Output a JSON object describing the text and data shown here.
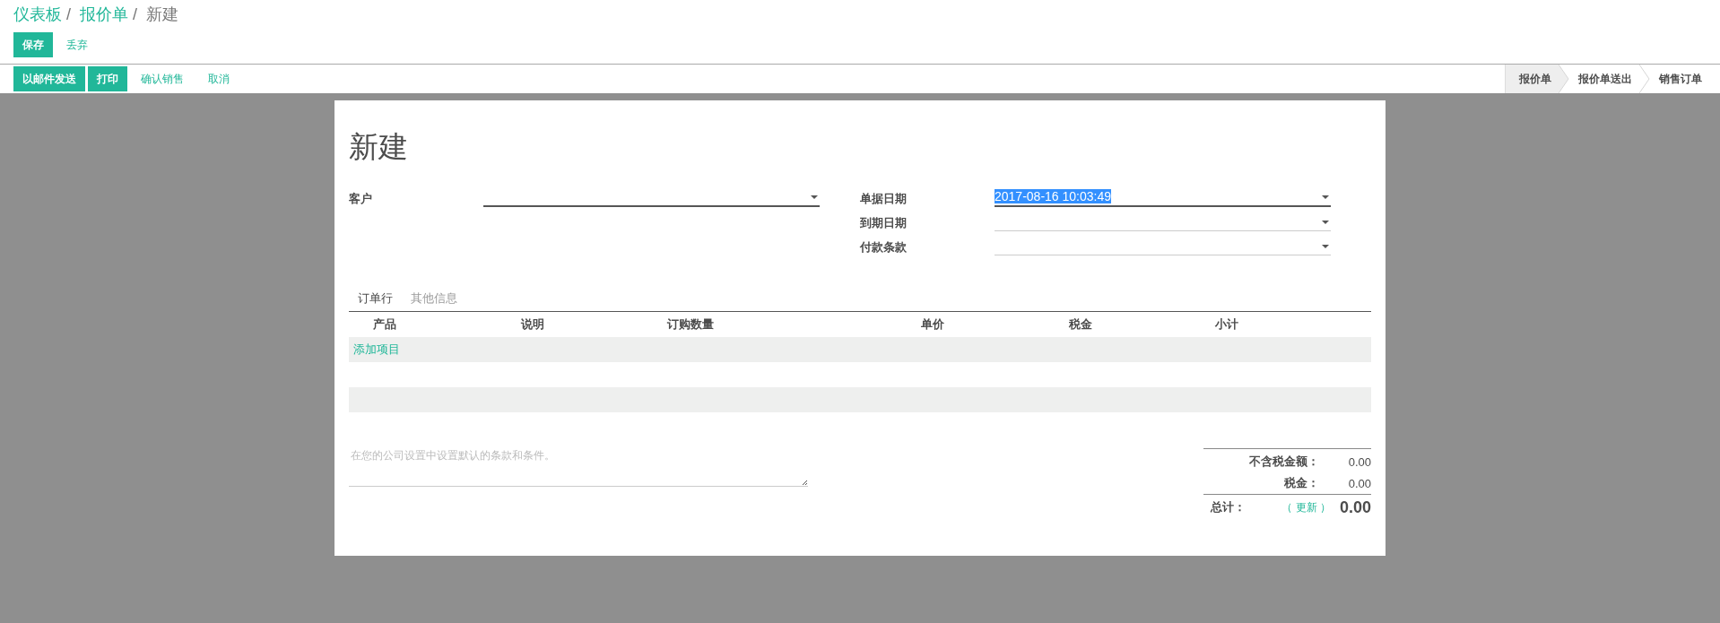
{
  "breadcrumbs": [
    {
      "label": "仪表板",
      "kind": "link",
      "separator": "/"
    },
    {
      "label": "报价单",
      "kind": "link",
      "separator": "/"
    },
    {
      "label": "新建",
      "kind": "current"
    }
  ],
  "edit_buttons": [
    {
      "label": "保存",
      "kind": "primary"
    },
    {
      "label": "丢弃",
      "kind": "link"
    }
  ],
  "action_buttons": [
    {
      "label": "以邮件发送",
      "kind": "primary"
    },
    {
      "label": "打印",
      "kind": "primary"
    },
    {
      "label": "确认销售",
      "kind": "link"
    },
    {
      "label": "取消",
      "kind": "link"
    }
  ],
  "stages": [
    {
      "label": "报价单",
      "selected": true
    },
    {
      "label": "报价单送出",
      "selected": false
    },
    {
      "label": "销售订单",
      "selected": false
    }
  ],
  "title": "新建",
  "left_fields": [
    {
      "label": "客户"
    }
  ],
  "right_fields": [
    {
      "label": "单据日期",
      "value": "2017-08-16 10:03:49"
    },
    {
      "label": "到期日期"
    },
    {
      "label": "付款条款"
    }
  ],
  "tabs": [
    {
      "label": "订单行",
      "selected": true
    },
    {
      "label": "其他信息",
      "selected": false
    }
  ],
  "table": {
    "columns": [
      "产品",
      "说明",
      "订购数量",
      "单价",
      "税金",
      "小计"
    ],
    "add_item": "添加项目"
  },
  "notes": {
    "placeholder": "在您的公司设置中设置默认的条款和条件。"
  },
  "totals": [
    {
      "label": "不含税金额：",
      "value": "0.00"
    },
    {
      "label": "税金：",
      "value": "0.00"
    }
  ],
  "grand_total": {
    "label": "总计：",
    "update_link": "（ 更新 ）",
    "value": "0.00"
  }
}
